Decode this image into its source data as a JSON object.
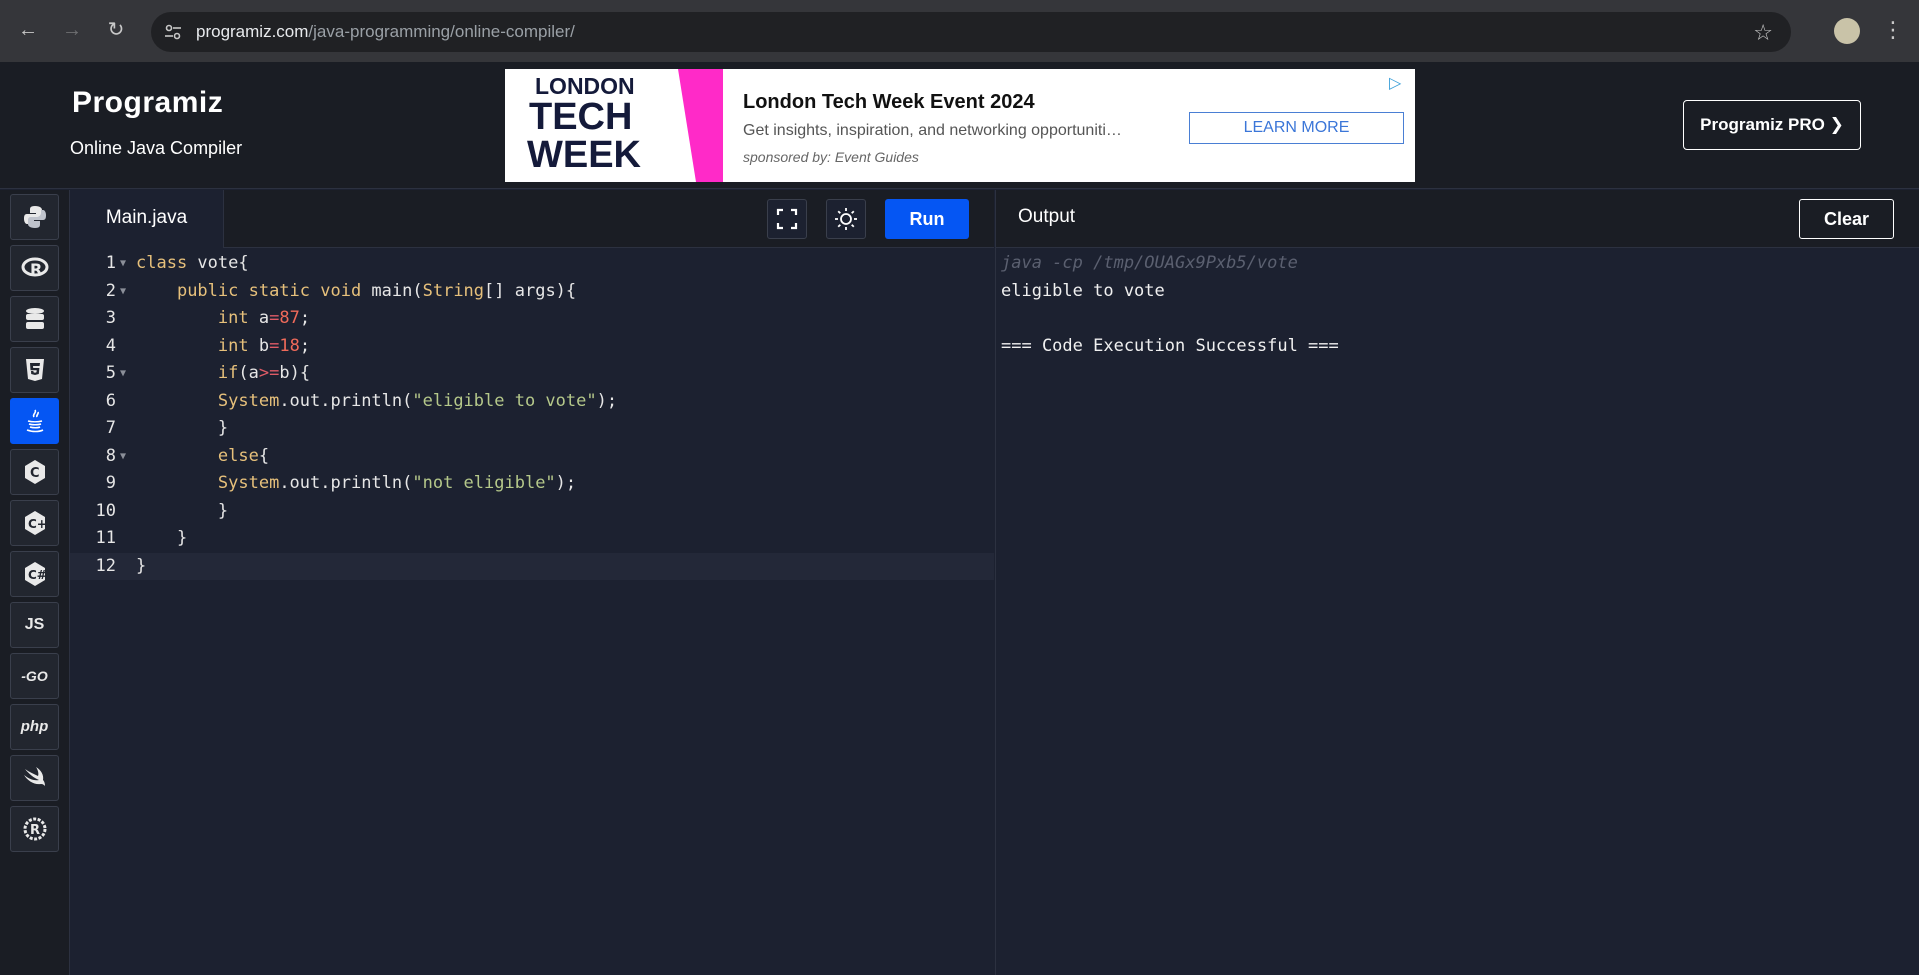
{
  "browser": {
    "url_host": "programiz.com",
    "url_path": "/java-programming/online-compiler/"
  },
  "header": {
    "logo": "Programiz",
    "subtitle": "Online Java Compiler",
    "pro_button": "Programiz PRO ❯"
  },
  "ad": {
    "logo_line1": "LONDON",
    "logo_line2": "TECH",
    "logo_line3": "WEEK",
    "title": "London Tech Week Event 2024",
    "description": "Get insights, inspiration, and networking opportuniti…",
    "sponsor": "sponsored by: Event Guides",
    "cta": "LEARN MORE"
  },
  "sidebar": {
    "items": [
      {
        "name": "python",
        "label": ""
      },
      {
        "name": "r",
        "label": ""
      },
      {
        "name": "sql",
        "label": ""
      },
      {
        "name": "html",
        "label": ""
      },
      {
        "name": "java",
        "label": ""
      },
      {
        "name": "c",
        "label": ""
      },
      {
        "name": "cpp",
        "label": ""
      },
      {
        "name": "csharp",
        "label": ""
      },
      {
        "name": "js",
        "label": "JS"
      },
      {
        "name": "go",
        "label": "-GO"
      },
      {
        "name": "php",
        "label": "php"
      },
      {
        "name": "swift",
        "label": ""
      },
      {
        "name": "rust",
        "label": ""
      }
    ],
    "active": "java"
  },
  "editor": {
    "tab": "Main.java",
    "run_label": "Run",
    "lines": [
      "1",
      "2",
      "3",
      "4",
      "5",
      "6",
      "7",
      "8",
      "9",
      "10",
      "11",
      "12"
    ]
  },
  "output": {
    "title": "Output",
    "clear_label": "Clear",
    "command": "java -cp /tmp/OUAGx9Pxb5/vote",
    "line1": "eligible to vote",
    "line2": "=== Code Execution Successful ==="
  },
  "colors": {
    "accent": "#0556f3",
    "background": "#1c2130"
  }
}
